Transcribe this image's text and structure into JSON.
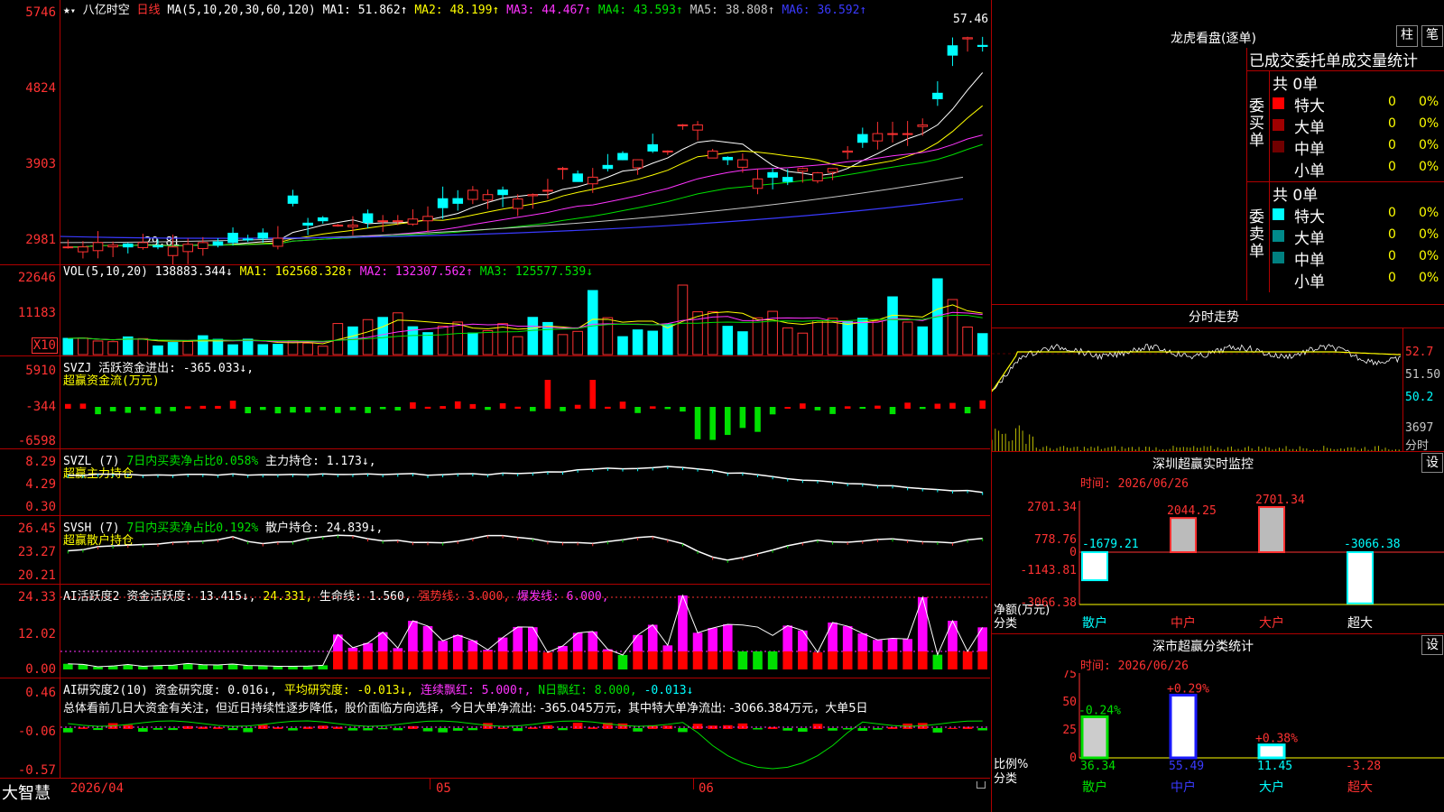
{
  "main": {
    "title_icons": [
      "star-icon",
      "triangle-icon"
    ],
    "stock_name": "八亿时空",
    "period": "日线",
    "ma_header": "MA(5,10,20,30,60,120)",
    "ma1": "MA1: 51.862↑",
    "ma2": "MA2: 48.199↑",
    "ma3": "MA3: 44.467↑",
    "ma4": "MA4: 43.593↑",
    "ma5": "MA5: 38.808↑",
    "ma6": "MA6: 36.592↑",
    "high_mark": "57.46",
    "low_mark": "29.81",
    "y_labels": [
      "5746",
      "4824",
      "3903",
      "2981"
    ]
  },
  "vol": {
    "header": "VOL(5,10,20)",
    "value": "138883.344↓",
    "ma1": "MA1: 162568.328↑",
    "ma2": "MA2: 132307.562↑",
    "ma3": "MA3: 125577.539↓",
    "y_labels": [
      "22646",
      "11183"
    ],
    "unit": "X10"
  },
  "svzj": {
    "header": "SVZJ",
    "text": "活跃资金进出: -365.033↓,",
    "sub": "超赢资金流(万元)",
    "y_labels": [
      "5910",
      "-344",
      "-6598"
    ]
  },
  "svzl": {
    "header": "SVZL (7)",
    "text1": "7日内买卖净占比0.058%",
    "text2": "主力持仓: 1.173↓,",
    "sub": "超赢主力持仓",
    "y_labels": [
      "8.29",
      "4.29",
      "0.30"
    ]
  },
  "svsh": {
    "header": "SVSH (7)",
    "text1": "7日内买卖净占比0.192%",
    "text2": "散户持仓: 24.839↓,",
    "sub": "超赢散户持仓",
    "y_labels": [
      "26.45",
      "23.27",
      "20.21"
    ]
  },
  "ai1": {
    "header": "AI活跃度2",
    "t1": "资金活跃度: 13.415↓,",
    "t2": "24.331,",
    "t3": "生命线: 1.560,",
    "t4": "强势线: 3.000,",
    "t5": "爆发线: 6.000,",
    "y_labels": [
      "24.33",
      "12.02",
      "0.00"
    ]
  },
  "ai2": {
    "header": "AI研究度2(10)",
    "t1": "资金研究度: 0.016↓,",
    "t2": "平均研究度: -0.013↓,",
    "t3": "连续飘红: 5.000↑,",
    "t4": "N日飘红: 8.000,",
    "t5": "-0.013↓",
    "comment": "总体看前几日大资金有关注，但近日持续性逐步降低，股价面临方向选择，今日大单净流出: -365.045万元，其中特大单净流出: -3066.384万元，大单5日",
    "y_labels": [
      "0.46",
      "-0.06",
      "-0.57"
    ]
  },
  "bottom": {
    "brand": "大智慧",
    "date_start": "2026/04",
    "m05": "05",
    "m06": "06"
  },
  "longhu": {
    "title": "龙虎看盘(逐单)",
    "btn1": "柱",
    "btn2": "笔",
    "header": "已成交委托单成交量统计",
    "buy_label": "委买单",
    "sell_label": "委卖单",
    "buy_total": "共 0单",
    "sell_total": "共 0单",
    "buy_rows": [
      {
        "name": "特大",
        "v": "0",
        "p": "0%",
        "color": "#ff0000"
      },
      {
        "name": "大单",
        "v": "0",
        "p": "0%",
        "color": "#a00000"
      },
      {
        "name": "中单",
        "v": "0",
        "p": "0%",
        "color": "#700000"
      },
      {
        "name": "小单",
        "v": "0",
        "p": "0%",
        "color": ""
      }
    ],
    "sell_rows": [
      {
        "name": "特大",
        "v": "0",
        "p": "0%",
        "color": "#00ffff"
      },
      {
        "name": "大单",
        "v": "0",
        "p": "0%",
        "color": "#008a8a"
      },
      {
        "name": "中单",
        "v": "0",
        "p": "0%",
        "color": "#008080"
      },
      {
        "name": "小单",
        "v": "0",
        "p": "0%",
        "color": ""
      }
    ]
  },
  "fenshi": {
    "title": "分时走势",
    "y_labels": [
      "52.7",
      "51.50",
      "50.2"
    ],
    "vol_label": "3697",
    "fenshi_label": "分时"
  },
  "sz_monitor": {
    "title": "深圳超赢实时监控",
    "btn": "设",
    "time": "时间: 2026/06/26",
    "y_labels": [
      "2701.34",
      "778.76",
      "0",
      "-1143.81",
      "-3066.38"
    ],
    "net_label": "净额(万元)",
    "cat_label": "分类",
    "bar_values": [
      "-1679.21",
      "2044.25",
      "2701.34",
      "-3066.38"
    ],
    "categories": [
      "散户",
      "中户",
      "大户",
      "超大"
    ]
  },
  "sz_class": {
    "title": "深市超赢分类统计",
    "btn": "设",
    "time": "时间: 2026/06/26",
    "y_labels": [
      "75",
      "50",
      "25",
      "0"
    ],
    "ratio_label": "比例%",
    "cat_label": "分类",
    "bar_changes": [
      "-0.24%",
      "+0.29%",
      "+0.38%",
      ""
    ],
    "bar_values": [
      "36.34",
      "55.49",
      "11.45",
      "-3.28"
    ],
    "categories": [
      "散户",
      "中户",
      "大户",
      "超大"
    ]
  },
  "chart_data": [
    {
      "type": "bar",
      "title": "深圳超赢实时监控",
      "categories": [
        "散户",
        "中户",
        "大户",
        "超大"
      ],
      "values": [
        -1679.21,
        2044.25,
        2701.34,
        -3066.38
      ],
      "ylabel": "净额(万元)",
      "ylim": [
        -3066.38,
        2701.34
      ]
    },
    {
      "type": "bar",
      "title": "深市超赢分类统计",
      "categories": [
        "散户",
        "中户",
        "大户",
        "超大"
      ],
      "values": [
        36.34,
        55.49,
        11.45,
        -3.28
      ],
      "ylabel": "比例%",
      "ylim": [
        0,
        75
      ]
    }
  ]
}
